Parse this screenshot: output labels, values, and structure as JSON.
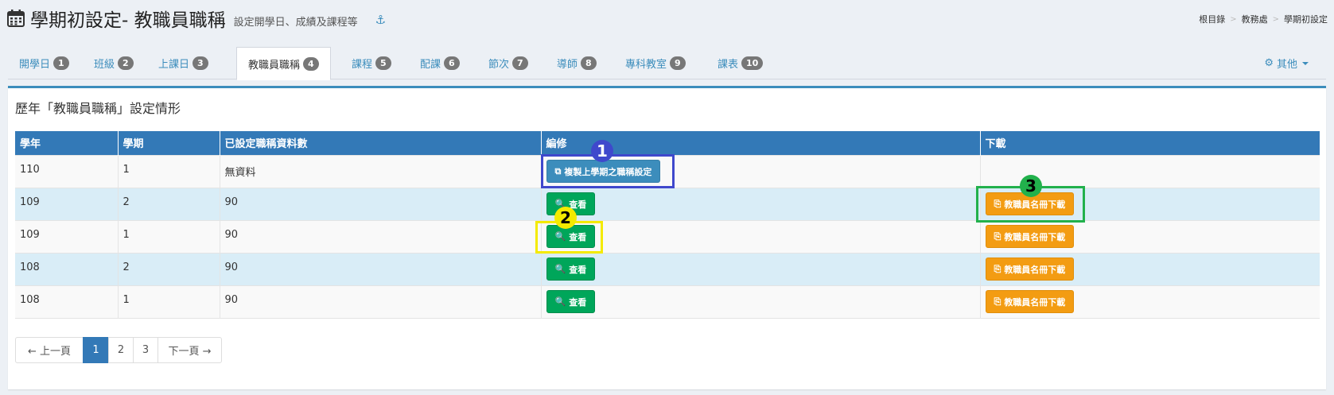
{
  "header": {
    "title": "學期初設定- 教職員職稱",
    "subtitle": "設定開學日、成績及課程等",
    "breadcrumb": [
      "根目錄",
      "教務處",
      "學期初設定"
    ]
  },
  "tabs": [
    {
      "label": "開學日",
      "badge": "1"
    },
    {
      "label": "班級",
      "badge": "2"
    },
    {
      "label": "上課日",
      "badge": "3"
    },
    {
      "label": "教職員職稱",
      "badge": "4",
      "active": true
    },
    {
      "label": "課程",
      "badge": "5"
    },
    {
      "label": "配課",
      "badge": "6"
    },
    {
      "label": "節次",
      "badge": "7"
    },
    {
      "label": "導師",
      "badge": "8"
    },
    {
      "label": "專科教室",
      "badge": "9"
    },
    {
      "label": "課表",
      "badge": "10"
    }
  ],
  "other_menu": "其他",
  "panel": {
    "title": "歷年「教職員職稱」設定情形",
    "columns": [
      "學年",
      "學期",
      "已設定職稱資料數",
      "編修",
      "下載"
    ],
    "rows": [
      {
        "year": "110",
        "semester": "1",
        "count": "無資料",
        "edit": "複製上學期之職稱設定",
        "download": ""
      },
      {
        "year": "109",
        "semester": "2",
        "count": "90",
        "edit": "查看",
        "download": "教職員名冊下載"
      },
      {
        "year": "109",
        "semester": "1",
        "count": "90",
        "edit": "查看",
        "download": "教職員名冊下載"
      },
      {
        "year": "108",
        "semester": "2",
        "count": "90",
        "edit": "查看",
        "download": "教職員名冊下載"
      },
      {
        "year": "108",
        "semester": "1",
        "count": "90",
        "edit": "查看",
        "download": "教職員名冊下載"
      }
    ]
  },
  "pagination": {
    "prev": "← 上一頁",
    "pages": [
      "1",
      "2",
      "3"
    ],
    "current": "1",
    "next": "下一頁 →"
  },
  "annotations": [
    "1",
    "2",
    "3"
  ],
  "colors": {
    "primary": "#3c8dbc",
    "table_header": "#3379b7",
    "success": "#00a65a",
    "warning": "#f39c12",
    "marker_blue": "#3f48cc",
    "marker_yellow": "#f4ea00",
    "marker_green": "#22b14c"
  }
}
